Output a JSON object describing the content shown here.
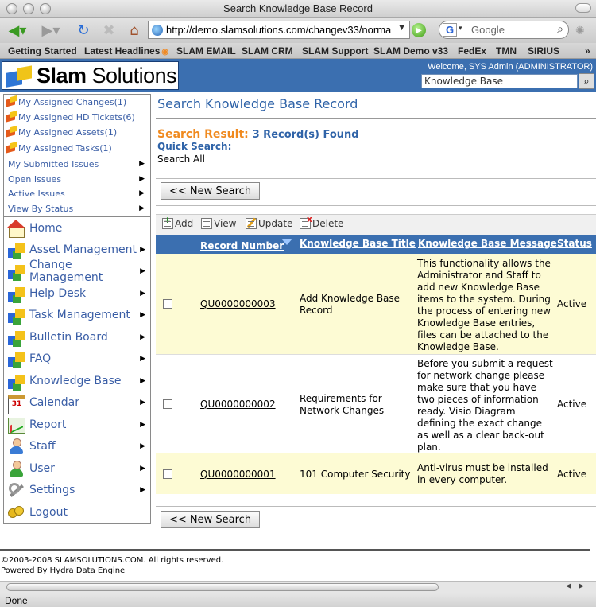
{
  "browser": {
    "title": "Search Knowledge Base Record",
    "url": "http://demo.slamsolutions.com/changev33/norma",
    "search_placeholder": "Google",
    "search_engine_letter": "G",
    "bookmarks": [
      "Getting Started",
      "Latest Headlines",
      "SLAM EMAIL",
      "SLAM CRM",
      "SLAM Support",
      "SLAM Demo v33",
      "FedEx",
      "TMN",
      "SIRIUS"
    ],
    "overflow": "»",
    "status": "Done"
  },
  "header": {
    "logo_bold": "Slam",
    "logo_rest": " Solutions",
    "welcome": "Welcome, SYS Admin (ADMINISTRATOR)",
    "search_value": "Knowledge Base"
  },
  "sidebar": {
    "quick_links": [
      "My Assigned Changes(1)",
      "My Assigned HD Tickets(6)",
      "My Assigned Assets(1)",
      "My Assigned Tasks(1)"
    ],
    "submenus": [
      "My Submitted Issues",
      "Open Issues",
      "Active Issues",
      "View By Status"
    ],
    "menu": [
      {
        "label": "Home",
        "icon": "home-icon",
        "arrow": false
      },
      {
        "label": "Asset Management",
        "icon": "cubes-icon",
        "arrow": true
      },
      {
        "label": "Change Management",
        "icon": "cubes-icon",
        "arrow": true
      },
      {
        "label": "Help Desk",
        "icon": "cubes-icon",
        "arrow": true
      },
      {
        "label": "Task Management",
        "icon": "cubes-icon",
        "arrow": true
      },
      {
        "label": "Bulletin Board",
        "icon": "cubes-icon",
        "arrow": true
      },
      {
        "label": "FAQ",
        "icon": "cubes-icon",
        "arrow": true
      },
      {
        "label": "Knowledge Base",
        "icon": "cubes-icon",
        "arrow": true
      },
      {
        "label": "Calendar",
        "icon": "calendar-icon",
        "arrow": true
      },
      {
        "label": "Report",
        "icon": "report-icon",
        "arrow": true
      },
      {
        "label": "Staff",
        "icon": "staff-icon",
        "arrow": true
      },
      {
        "label": "User",
        "icon": "user-icon",
        "arrow": true
      },
      {
        "label": "Settings",
        "icon": "wrench-icon",
        "arrow": true
      },
      {
        "label": "Logout",
        "icon": "keys-icon",
        "arrow": false
      }
    ],
    "arrow_glyph": "▶"
  },
  "main": {
    "page_title": "Search Knowledge Base Record",
    "search_result_label": "Search Result:",
    "search_result_count": "3 Record(s) Found",
    "quick_search_label": "Quick Search:",
    "quick_search_value": "Search All",
    "new_search_label": "<< New Search",
    "toolbar": {
      "add": "Add",
      "view": "View",
      "update": "Update",
      "delete": "Delete"
    },
    "columns": [
      "Record Number",
      "Knowledge Base Title",
      "Knowledge Base Message",
      "Status"
    ],
    "rows": [
      {
        "record": "QU0000000003",
        "title": "Add Knowledge Base Record",
        "message": "This functionality allows the Administrator and Staff to add new Knowledge Base items to the system. During the process of entering new Knowledge Base entries, files can be attached to the Knowledge Base.",
        "status": "Active"
      },
      {
        "record": "QU0000000002",
        "title": "Requirements for Network Changes",
        "message": "Before you submit a request for network change please make sure that you have two pieces of information ready. Visio Diagram defining the exact change as well as a clear back-out plan.",
        "status": "Active"
      },
      {
        "record": "QU0000000001",
        "title": "101 Computer Security",
        "message": "Anti-virus must be installed in every computer.",
        "status": "Active"
      }
    ]
  },
  "footer": {
    "copyright": "©2003-2008 SLAMSOLUTIONS.COM. All rights reserved.",
    "powered": "Powered By Hydra Data Engine"
  },
  "colors": {
    "header_blue": "#3b6fb0",
    "link_blue": "#3a5ea6",
    "accent_orange": "#f08a1f",
    "row_highlight": "#fdfbd4"
  }
}
